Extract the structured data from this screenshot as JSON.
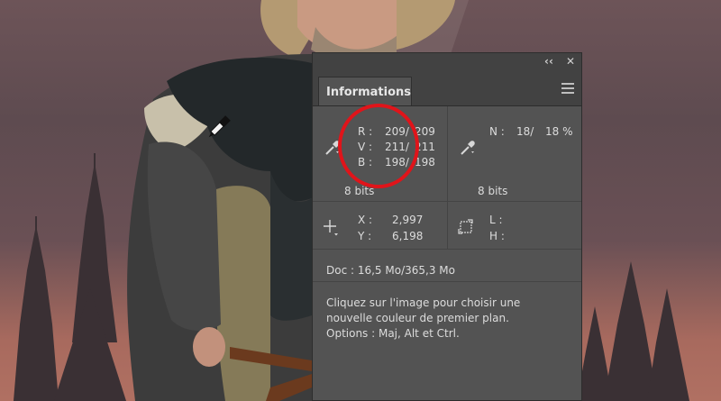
{
  "panel": {
    "collapse_icon": "double-chevron-left-icon",
    "close_icon": "close-icon",
    "tab_label": "Informations",
    "menu_icon": "panel-menu-icon"
  },
  "rgb": {
    "r_label": "R :",
    "v_label": "V :",
    "b_label": "B :",
    "r_value": "209/",
    "v_value": "211/",
    "b_value": "198/",
    "r_value2": "209",
    "v_value2": "211",
    "b_value2": "198",
    "bits": "8 bits",
    "icon": "eyedropper-icon"
  },
  "gray": {
    "n_label": "N :",
    "n_value": "18/",
    "n_value2": "18 %",
    "bits": "8 bits",
    "icon": "eyedropper-icon"
  },
  "coords": {
    "x_label": "X :",
    "y_label": "Y :",
    "x_value": "2,997",
    "y_value": "6,198",
    "icon": "crosshair-icon"
  },
  "size": {
    "l_label": "L :",
    "h_label": "H :",
    "icon": "selection-size-icon"
  },
  "doc": {
    "text": "Doc : 16,5 Mo/365,3 Mo"
  },
  "hint": {
    "line1": "Cliquez sur l'image pour choisir une",
    "line2": "nouvelle couleur de premier plan.",
    "line3": "Options : Maj, Alt et Ctrl."
  },
  "colors": {
    "panel_bg": "#535353",
    "titlebar_bg": "#424242",
    "highlight_circle": "#e0141a"
  }
}
